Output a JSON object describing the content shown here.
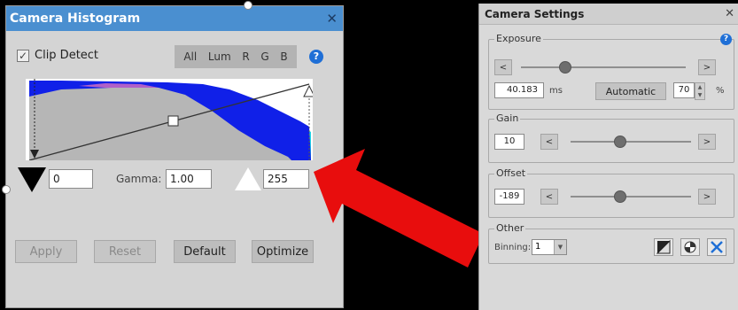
{
  "histogram_window": {
    "title": "Camera Histogram",
    "close_glyph": "✕",
    "clip_detect_label": "Clip Detect",
    "clip_detect_checked": true,
    "channels": [
      "All",
      "Lum",
      "R",
      "G",
      "B"
    ],
    "help_glyph": "?",
    "min_value": "0",
    "gamma_label": "Gamma:",
    "gamma_value": "1.00",
    "max_value": "255",
    "buttons": {
      "apply": "Apply",
      "reset": "Reset",
      "default": "Default",
      "optimize": "Optimize"
    }
  },
  "settings_window": {
    "title": "Camera Settings",
    "close_glyph": "✕",
    "exposure": {
      "label": "Exposure",
      "value": "40.183",
      "unit": "ms",
      "automatic_label": "Automatic",
      "auto_percent": "70",
      "percent_sign": "%",
      "slider_fraction": 0.25
    },
    "gain": {
      "label": "Gain",
      "value": "10",
      "slider_fraction": 0.4
    },
    "offset": {
      "label": "Offset",
      "value": "-189",
      "slider_fraction": 0.4
    },
    "other": {
      "label": "Other",
      "binning_label": "Binning:",
      "binning_value": "1"
    },
    "arrow_left": "<",
    "arrow_right": ">"
  },
  "colors": {
    "title_bar": "#4a8fd0",
    "histogram_blue": "#1020e8",
    "histogram_cyan": "#20d8e8",
    "arrow_red": "#e80d0d"
  }
}
